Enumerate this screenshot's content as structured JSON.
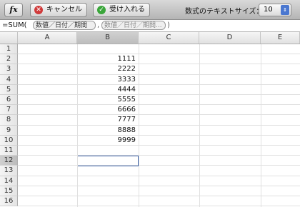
{
  "toolbar": {
    "fx_label": "fx",
    "cancel_label": "キャンセル",
    "accept_label": "受け入れる",
    "font_size_label": "数式のテキストサイズ：",
    "font_size_value": "10",
    "colors": {
      "cancel_icon": "#d03a3a",
      "accept_icon": "#3aa63a",
      "select_arrow": "#4a77d0"
    }
  },
  "formula": {
    "prefix": "=SUM(",
    "token1": "数値／日付／期間",
    "separator": ",",
    "token2": "数値／日付／期間...",
    "suffix": ")"
  },
  "columns": [
    "",
    "A",
    "B",
    "C",
    "D",
    "E"
  ],
  "rows": [
    "1",
    "2",
    "3",
    "4",
    "5",
    "6",
    "7",
    "8",
    "9",
    "10",
    "11",
    "12",
    "13",
    "14",
    "15",
    "16"
  ],
  "column_b_values": [
    "1111",
    "2222",
    "3333",
    "4444",
    "5555",
    "6666",
    "7777",
    "8888",
    "9999"
  ],
  "selected_cell": "B12"
}
